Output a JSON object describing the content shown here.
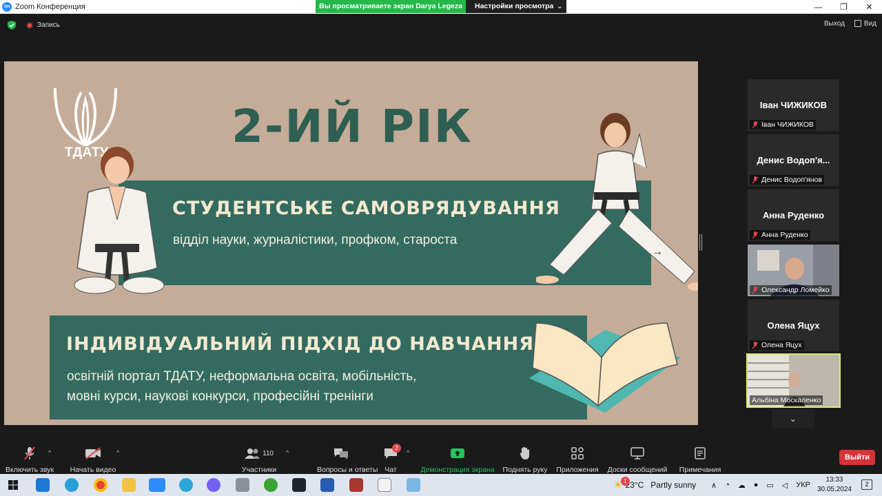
{
  "window": {
    "app_title": "Zoom Конференция",
    "minimize": "—",
    "maximize": "❐",
    "close": "✕"
  },
  "share_banner": {
    "viewing_text": "Вы просматриваете экран Darya Legeza",
    "view_options_label": "Настройки просмотра"
  },
  "top_bar": {
    "record_label": "Запись",
    "exit_label": "Выход",
    "view_label": "Вид"
  },
  "slide": {
    "logo_text": "ТДАТУ",
    "title": "2-ИЙ РІК",
    "section1_title": "СТУДЕНТСЬКЕ САМОВРЯДУВАННЯ",
    "section1_text": "відділ науки, журналістики, профком, староста",
    "section2_title": "ІНДИВІДУАЛЬНИЙ ПІДХІД ДО НАВЧАННЯ",
    "section2_line1": "освітній портал ТДАТУ, неформальна освіта, мобільність,",
    "section2_line2": "мовні курси, наукові конкурси, професійні тренінги",
    "colors": {
      "background": "#c4ac98",
      "panel": "#336b60",
      "title": "#2f5e52"
    }
  },
  "participants": [
    {
      "display_name": "Іван ЧИЖИКОВ",
      "label": "Іван ЧИЖИКОВ",
      "video": false,
      "muted": true
    },
    {
      "display_name": "Денис Водоп'я...",
      "label": "Денис Водоп'янов",
      "video": false,
      "muted": true
    },
    {
      "display_name": "Анна Руденко",
      "label": "Анна Руденко",
      "video": false,
      "muted": true
    },
    {
      "display_name": "",
      "label": "Олександр Ломейко",
      "video": true,
      "muted": true
    },
    {
      "display_name": "Олена Яцух",
      "label": "Олена Яцух",
      "video": false,
      "muted": true
    },
    {
      "display_name": "",
      "label": "Альбіна Москаленко",
      "video": true,
      "muted": false,
      "active_speaker": true
    }
  ],
  "toolbar": {
    "unmute": "Включить звук",
    "start_video": "Начать видео",
    "participants": "Участники",
    "participants_count": "110",
    "qa": "Вопросы и ответы",
    "chat": "Чат",
    "chat_badge": "2",
    "share_screen": "Демонстрация экрана",
    "raise_hand": "Поднять руку",
    "apps": "Приложения",
    "whiteboards": "Доски сообщений",
    "notes": "Примечания",
    "leave": "Выйти"
  },
  "taskbar": {
    "weather_temp": "23°C",
    "weather_text": "Partly sunny",
    "weather_badge": "1",
    "language": "УКР",
    "time": "13:33",
    "date": "30.05.2024",
    "notifications": "2"
  }
}
